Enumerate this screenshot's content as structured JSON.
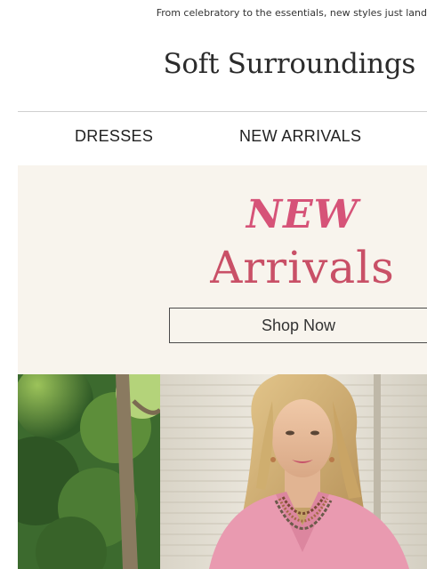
{
  "preheader": {
    "text": "From celebratory to the essentials, new styles just land"
  },
  "brand": {
    "logo_text": "Soft Surroundings"
  },
  "nav": {
    "items": [
      {
        "label": "DRESSES"
      },
      {
        "label": "NEW ARRIVALS"
      }
    ]
  },
  "hero": {
    "headline_accent": "NEW",
    "headline": "Arrivals",
    "cta_label": "Shop Now",
    "accent_color": "#d65378",
    "background_color": "#f8f4ed"
  },
  "photo": {
    "subject": "woman-pink-cardigan-beaded-necklaces"
  }
}
